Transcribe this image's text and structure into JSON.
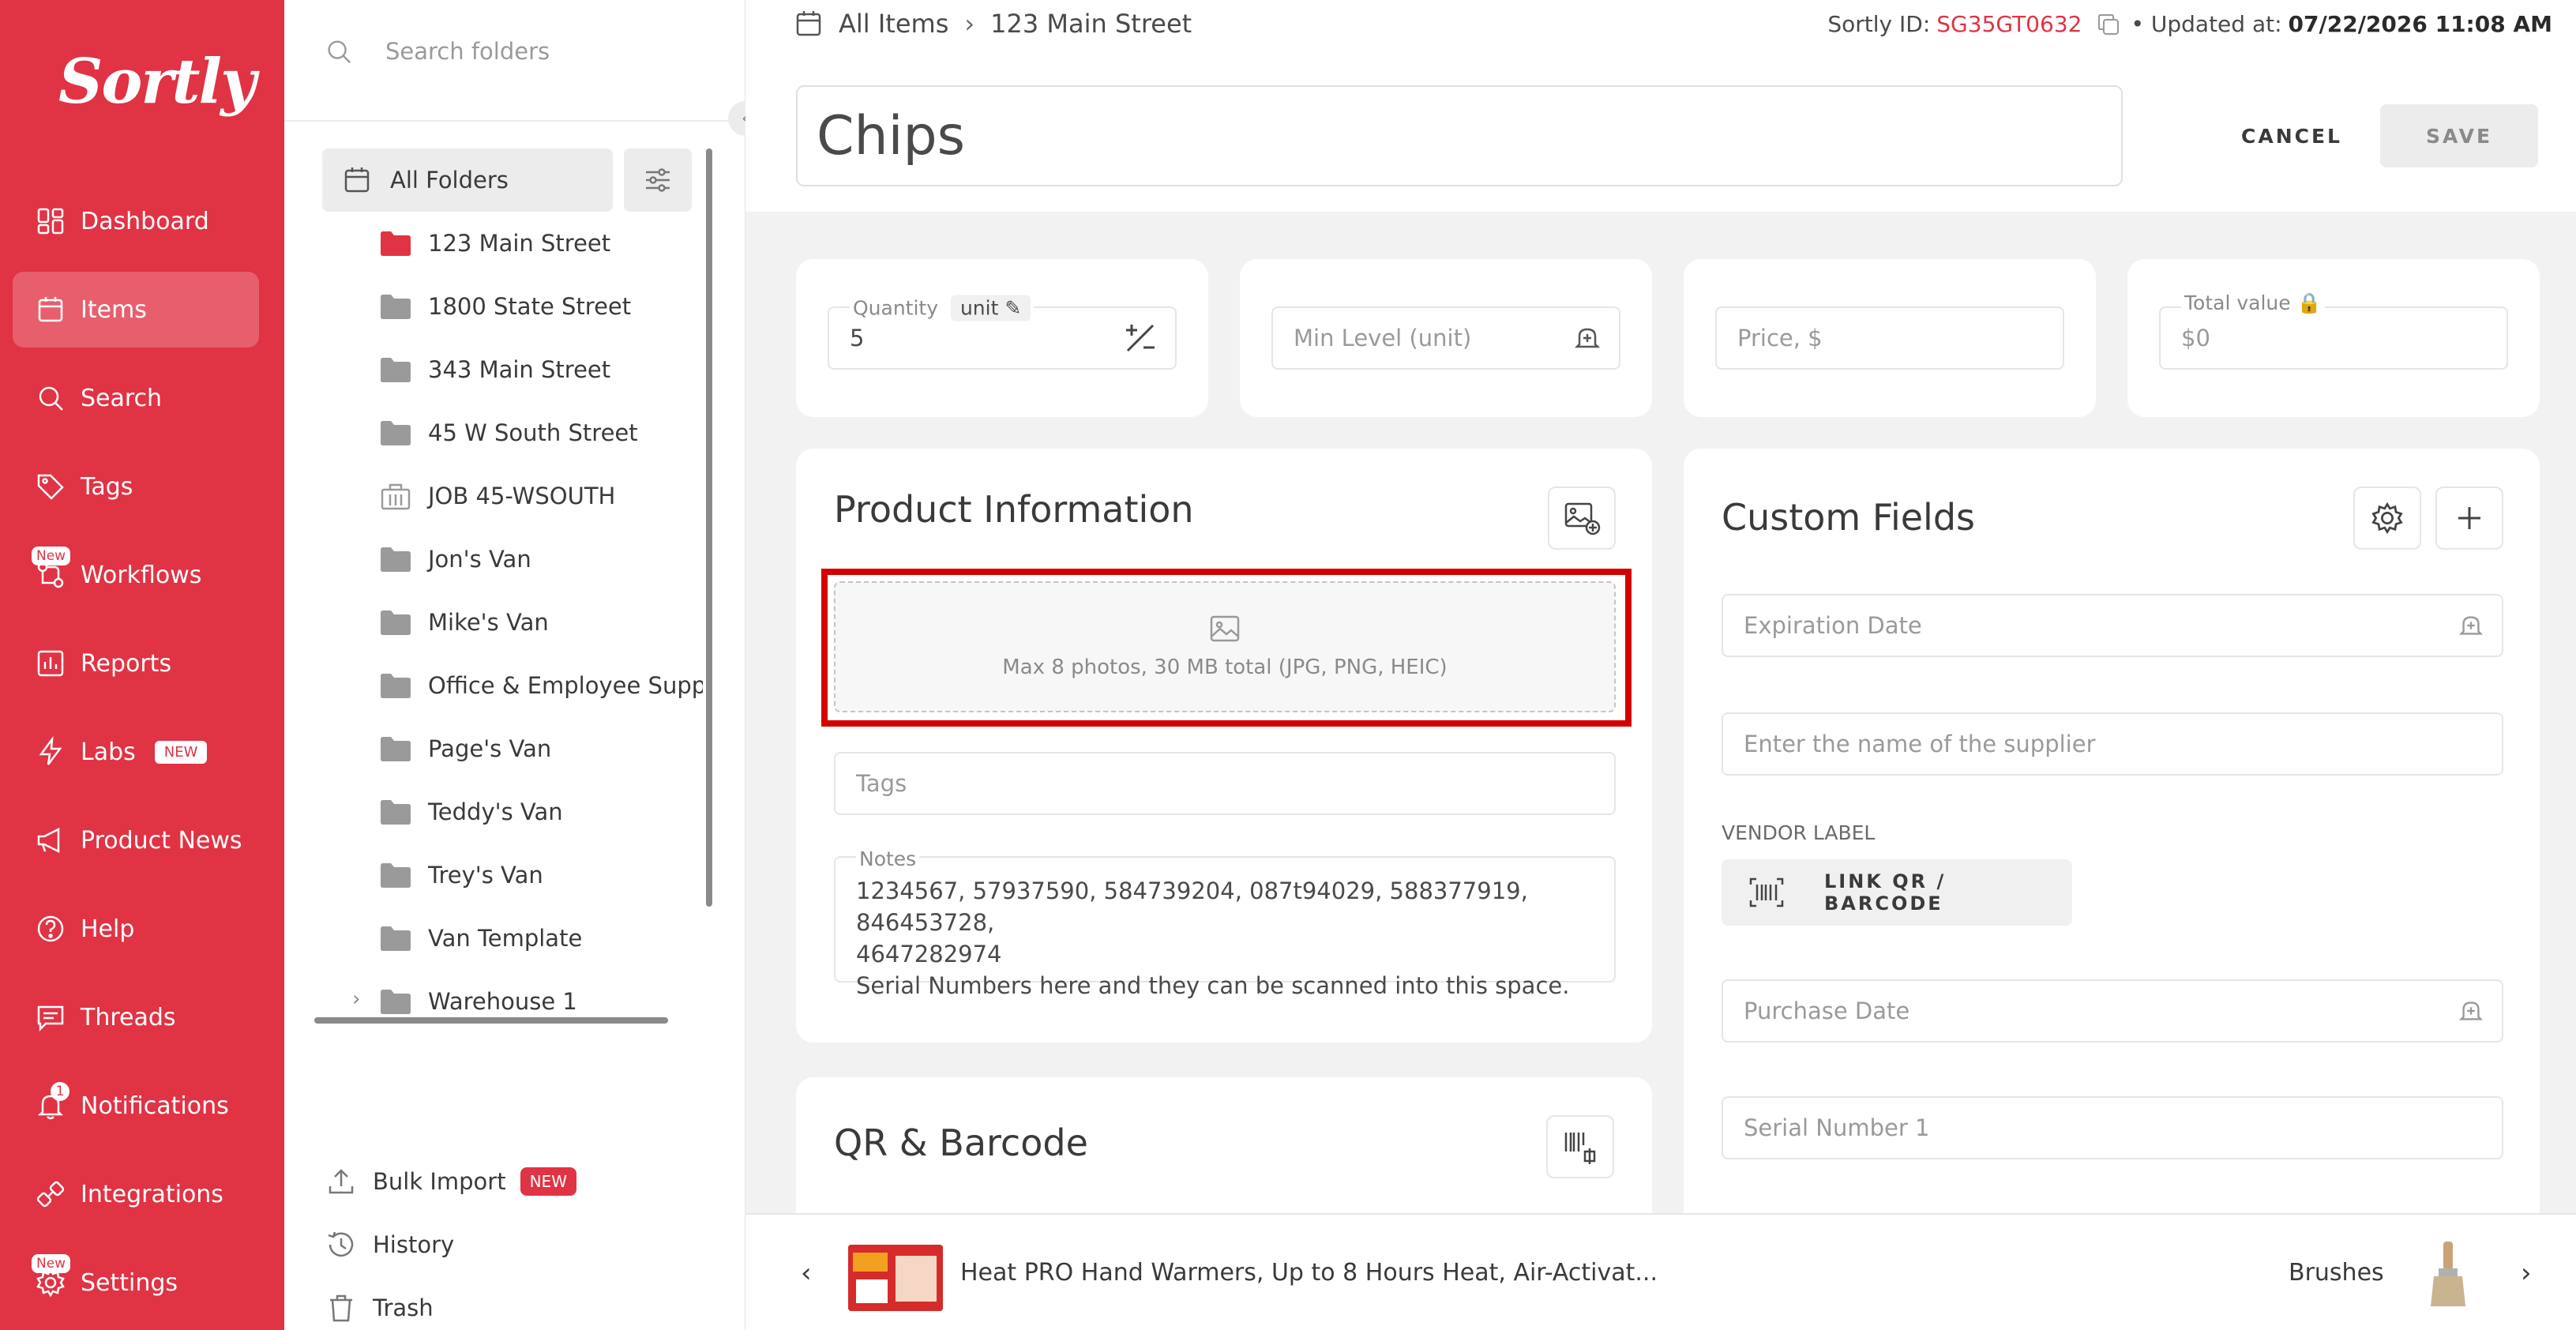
{
  "brand": {
    "logo_text": "Sortly",
    "accent": "#e03344"
  },
  "nav": {
    "items": [
      {
        "label": "Dashboard",
        "icon": "dashboard-icon"
      },
      {
        "label": "Items",
        "icon": "items-icon",
        "active": true
      },
      {
        "label": "Search",
        "icon": "search-icon"
      },
      {
        "label": "Tags",
        "icon": "tag-icon"
      },
      {
        "label": "Workflows",
        "icon": "workflows-icon",
        "badge": "New"
      },
      {
        "label": "Reports",
        "icon": "reports-icon"
      },
      {
        "label": "Labs",
        "icon": "lightning-icon",
        "pill": "NEW"
      },
      {
        "label": "Product News",
        "icon": "megaphone-icon"
      },
      {
        "label": "Help",
        "icon": "help-icon"
      },
      {
        "label": "Threads",
        "icon": "threads-icon"
      },
      {
        "label": "Notifications",
        "icon": "bell-icon",
        "count": "1"
      },
      {
        "label": "Integrations",
        "icon": "integrations-icon"
      },
      {
        "label": "Settings",
        "icon": "gear-icon",
        "badge": "New"
      }
    ]
  },
  "folders": {
    "search_placeholder": "Search folders",
    "all_label": "All Folders",
    "items": [
      {
        "label": "123 Main Street",
        "color": "#e03344"
      },
      {
        "label": "1800 State Street"
      },
      {
        "label": "343 Main Street"
      },
      {
        "label": "45 W South Street"
      },
      {
        "label": "JOB 45-WSOUTH",
        "icon": "building-icon"
      },
      {
        "label": "Jon's Van"
      },
      {
        "label": "Mike's Van"
      },
      {
        "label": "Office & Employee Suppli"
      },
      {
        "label": "Page's Van"
      },
      {
        "label": "Teddy's Van"
      },
      {
        "label": "Trey's Van"
      },
      {
        "label": "Van Template"
      },
      {
        "label": "Warehouse 1",
        "expandable": true
      }
    ],
    "bottom": {
      "bulk_import": "Bulk Import",
      "bulk_import_pill": "NEW",
      "history": "History",
      "trash": "Trash"
    }
  },
  "header": {
    "breadcrumb_root": "All Items",
    "breadcrumb_current": "123 Main Street",
    "sortly_id_label": "Sortly ID:",
    "sortly_id": "SG35GT0632",
    "updated_label": "• Updated at:",
    "updated_value": "07/22/2026 11:08 AM",
    "item_name": "Chips",
    "cancel": "CANCEL",
    "save": "SAVE"
  },
  "stats": {
    "quantity_label": "Quantity",
    "unit_chip": "unit",
    "quantity_value": "5",
    "min_level_placeholder": "Min Level (unit)",
    "price_placeholder": "Price, $",
    "total_label": "Total value",
    "total_value": "$0"
  },
  "product": {
    "title": "Product Information",
    "photo_hint": "Max 8 photos, 30 MB total (JPG, PNG, HEIC)",
    "tags_placeholder": "Tags",
    "notes_label": "Notes",
    "notes_line1": "1234567, 57937590, 584739204, 087t94029, 588377919, 846453728,",
    "notes_line2": "4647282974",
    "notes_line3": "Serial Numbers here and they can be scanned into this space."
  },
  "custom": {
    "title": "Custom Fields",
    "expiration_placeholder": "Expiration Date",
    "supplier_placeholder": "Enter the name of the supplier",
    "vendor_label": "VENDOR LABEL",
    "link_qr": "LINK QR / BARCODE",
    "purchase_placeholder": "Purchase Date",
    "serial_placeholder": "Serial Number 1"
  },
  "qr": {
    "title": "QR & Barcode"
  },
  "bottombar": {
    "prev_item": "Heat PRO Hand Warmers, Up to 8 Hours Heat, Air-Activat...",
    "next_item": "Brushes"
  }
}
